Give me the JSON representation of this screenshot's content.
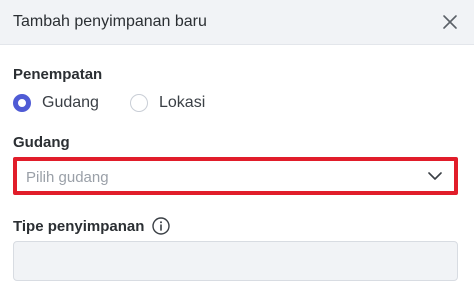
{
  "dialog": {
    "title": "Tambah penyimpanan baru",
    "close_icon": "close-icon"
  },
  "placement": {
    "label": "Penempatan",
    "options": [
      {
        "label": "Gudang",
        "selected": true
      },
      {
        "label": "Lokasi",
        "selected": false
      }
    ]
  },
  "warehouse": {
    "label": "Gudang",
    "placeholder": "Pilih gudang",
    "icon": "chevron-down-icon"
  },
  "storage_type": {
    "label": "Tipe penyimpanan",
    "info_icon": "info-icon",
    "value": ""
  },
  "colors": {
    "accent": "#4f5bd5",
    "highlight": "#e11d2a"
  }
}
